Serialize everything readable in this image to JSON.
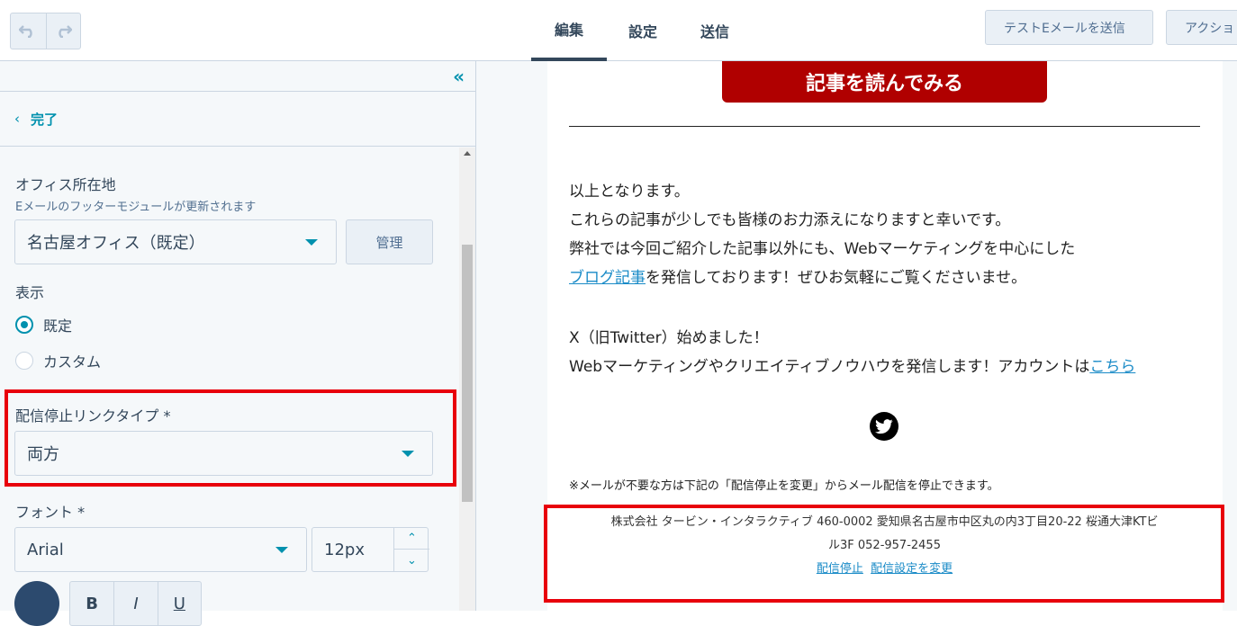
{
  "toolbar": {
    "undo_icon": "undo-icon",
    "redo_icon": "redo-icon",
    "tabs": [
      {
        "label": "編集",
        "active": true
      },
      {
        "label": "設定",
        "active": false
      },
      {
        "label": "送信",
        "active": false
      }
    ],
    "test_email_label": "テストEメールを送信",
    "actions_label": "アクショ"
  },
  "sidebar": {
    "collapse_icon": "double-chevron-left-icon",
    "done_label": "完了",
    "office": {
      "label": "オフィス所在地",
      "help": "Eメールのフッターモジュールが更新されます",
      "selected": "名古屋オフィス（既定）",
      "manage_label": "管理"
    },
    "display": {
      "label": "表示",
      "options": [
        {
          "label": "既定",
          "checked": true
        },
        {
          "label": "カスタム",
          "checked": false
        }
      ]
    },
    "unsubscribe": {
      "label": "配信停止リンクタイプ *",
      "selected": "両方"
    },
    "font": {
      "label": "フォント *",
      "family": "Arial",
      "size": "12px"
    },
    "format": {
      "bold": "B",
      "italic": "I",
      "underline": "U",
      "color": "#2c4a6e"
    }
  },
  "email": {
    "cta_label": "記事を読んでみる",
    "para1": [
      "以上となります。",
      "これらの記事が少しでも皆様のお力添えになりますと幸いです。",
      "弊社では今回ご紹介した記事以外にも、Webマーケティングを中心にした"
    ],
    "blog_link": "ブログ記事",
    "blog_suffix": "を発信しております！ぜひお気軽にご覧くださいませ。",
    "para2_line1": "X（旧Twitter）始めました！",
    "para2_line2": "Webマーケティングやクリエイティブノウハウを発信します！アカウントは",
    "para2_link": "こちら",
    "social_icon": "twitter-icon",
    "note": "※メールが不要な方は下記の「配信停止を変更」からメール配信を停止できます。",
    "footer_line1": "株式会社 タービン・インタラクティブ 460-0002 愛知県名古屋市中区丸の内3丁目20-22 桜通大津KTビ",
    "footer_line2": "ル3F 052-957-2455",
    "unsubscribe_link": "配信停止",
    "preferences_link": "配信設定を変更"
  },
  "colors": {
    "accent": "#0091ae",
    "highlight": "#e8000b",
    "cta": "#b00000",
    "link": "#1a8bc7"
  }
}
